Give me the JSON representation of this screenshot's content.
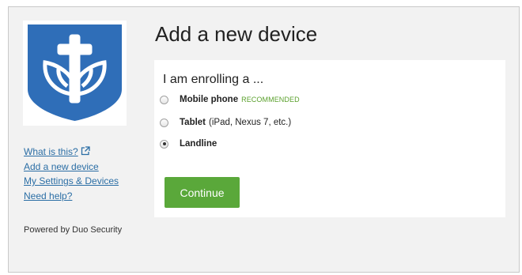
{
  "logo": {
    "name": "university-shield-logo",
    "colors": {
      "shield": "#2f6eb8",
      "emblem": "#ffffff"
    }
  },
  "sidebar": {
    "links": [
      {
        "label": "What is this?",
        "icon": "external-link-icon"
      },
      {
        "label": "Add a new device"
      },
      {
        "label": "My Settings & Devices"
      },
      {
        "label": "Need help?"
      }
    ],
    "powered_by": "Powered by Duo Security"
  },
  "main": {
    "title": "Add a new device",
    "panel": {
      "heading": "I am enrolling a ...",
      "options": [
        {
          "label": "Mobile phone",
          "note": "",
          "badge": "RECOMMENDED",
          "selected": false
        },
        {
          "label": "Tablet",
          "note": "(iPad, Nexus 7, etc.)",
          "badge": "",
          "selected": false
        },
        {
          "label": "Landline",
          "note": "",
          "badge": "",
          "selected": true
        }
      ],
      "continue_label": "Continue"
    }
  },
  "colors": {
    "link": "#2b6ea5",
    "button": "#5aa83a",
    "recommended": "#5aa02c",
    "frame_background": "#f2f2f2"
  }
}
